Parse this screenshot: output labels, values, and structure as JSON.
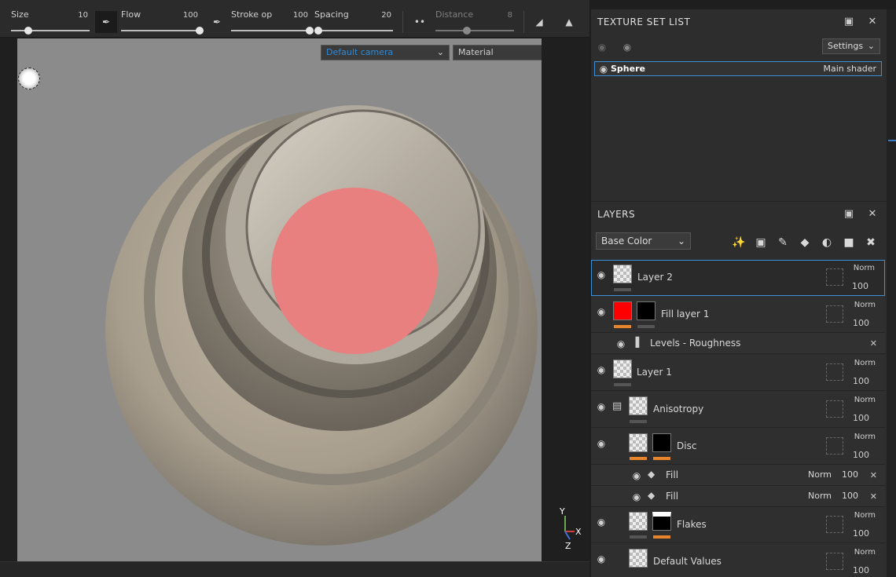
{
  "toolbar": {
    "size_label": "Size",
    "size_value": "10",
    "size_level": 0.22,
    "flow_label": "Flow",
    "flow_value": "100",
    "flow_level": 1.0,
    "stroke_label": "Stroke op",
    "stroke_value": "100",
    "stroke_level": 1.0,
    "spacing_label": "Spacing",
    "spacing_value": "20",
    "spacing_level": 0.05,
    "distance_label": "Distance",
    "distance_value": "8",
    "distance_level": 0.4
  },
  "viewport": {
    "camera": "Default camera",
    "channel": "Material",
    "axis_x": "X",
    "axis_y": "Y",
    "axis_z": "Z",
    "camera_color": "#2e8ad8"
  },
  "texture_set_list": {
    "title": "TEXTURE SET LIST",
    "settings_label": "Settings",
    "item_name": "Sphere",
    "item_shader": "Main shader"
  },
  "layers": {
    "title": "LAYERS",
    "channel": "Base Color",
    "rows": [
      {
        "name": "Layer 2",
        "blend": "Norm",
        "opacity": "100"
      },
      {
        "name": "Fill layer 1",
        "blend": "Norm",
        "opacity": "100"
      },
      {
        "name": "Levels - Roughness"
      },
      {
        "name": "Layer 1",
        "blend": "Norm",
        "opacity": "100"
      },
      {
        "name": "Anisotropy",
        "blend": "Norm",
        "opacity": "100"
      },
      {
        "name": "Disc",
        "blend": "Norm",
        "opacity": "100"
      },
      {
        "name": "Fill",
        "blend": "Norm",
        "opacity": "100"
      },
      {
        "name": "Fill",
        "blend": "Norm",
        "opacity": "100"
      },
      {
        "name": "Flakes",
        "blend": "Norm",
        "opacity": "100"
      },
      {
        "name": "Default Values",
        "blend": "Norm",
        "opacity": "100"
      }
    ]
  },
  "colors": {
    "accent_blue": "#3f8fd8",
    "mask_orange": "#e8842c",
    "fill_red": "#ff0000",
    "disc_pink": "#e88080"
  }
}
